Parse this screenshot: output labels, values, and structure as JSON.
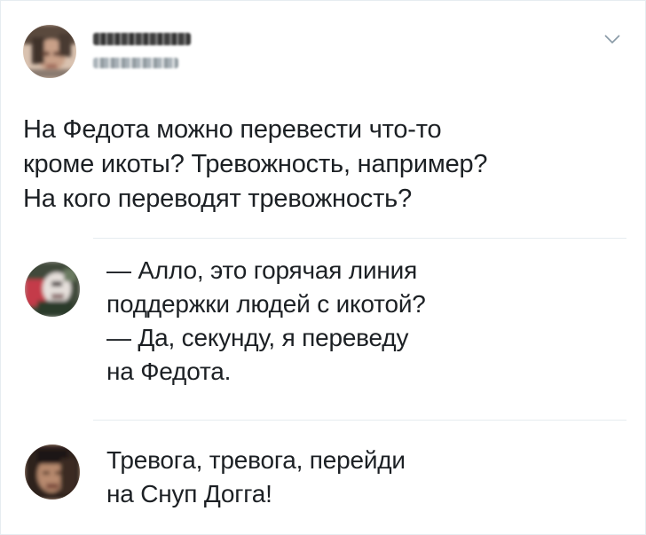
{
  "tweet": {
    "author": {
      "avatar_icon": "avatar-blurred-icon",
      "name_obscured": true,
      "handle_obscured": true
    },
    "menu_icon": "chevron-down-icon",
    "text": "На Федота можно перевести что-то\nкроме икоты? Тревожность, например?\nНа кого переводят тревожность?"
  },
  "replies": [
    {
      "avatar_icon": "avatar-blurred-icon",
      "text": "— Алло, это горячая линия\nподдержки людей с икотой?\n— Да, секунду, я переведу\nна Федота."
    },
    {
      "avatar_icon": "avatar-blurred-icon",
      "text": "Тревога, тревога, перейди\nна Снуп Догга!"
    }
  ],
  "colors": {
    "text": "#1c2024",
    "divider": "#e6ecf0",
    "chevron": "#8899a6",
    "border": "#e6ecf0"
  }
}
